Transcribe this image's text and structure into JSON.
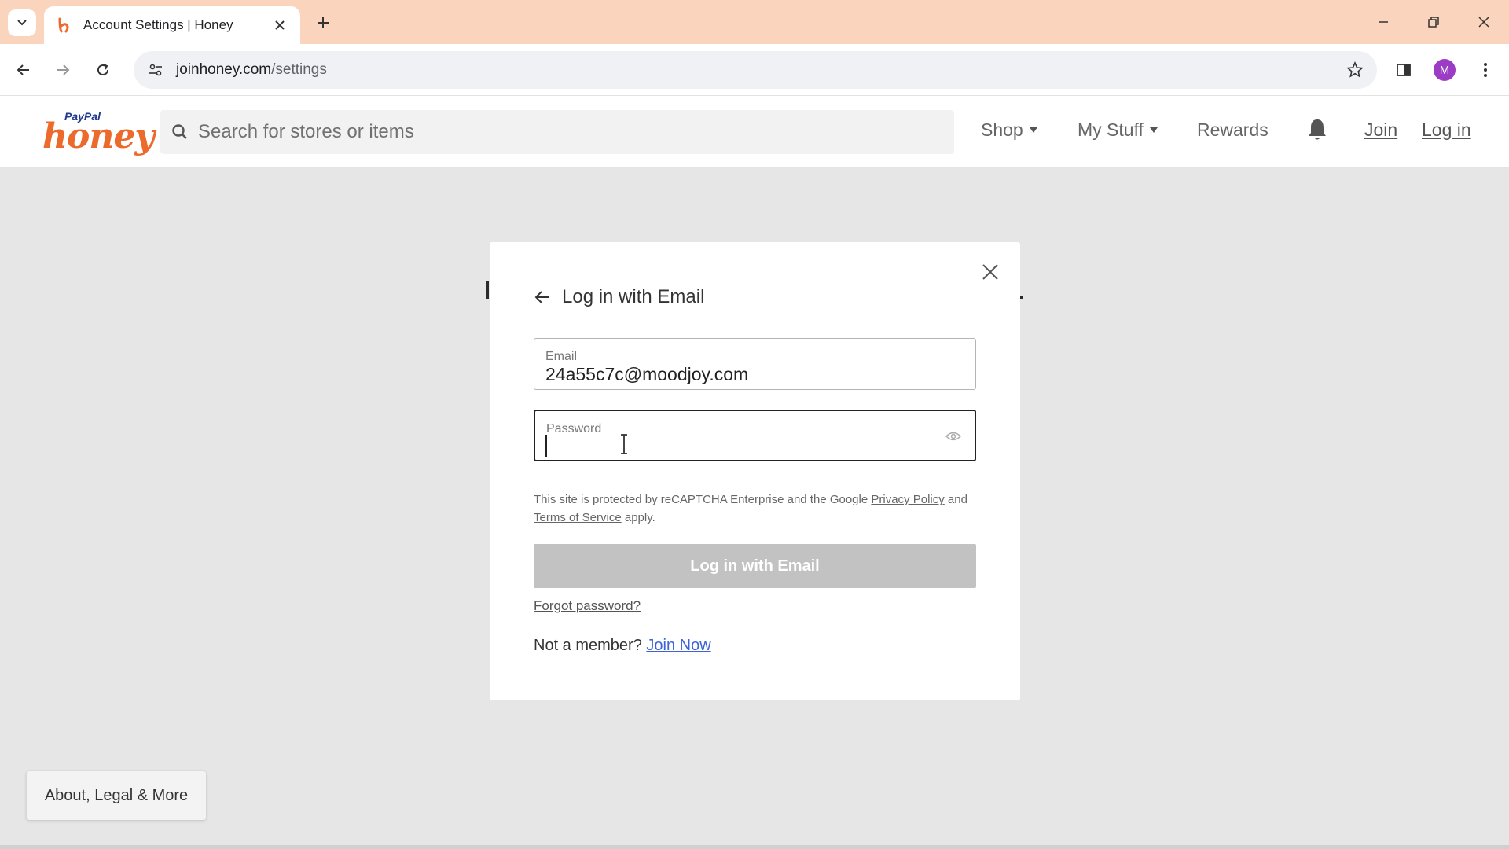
{
  "browser": {
    "tab_title": "Account Settings | Honey",
    "url_host": "joinhoney.com",
    "url_path": "/settings",
    "profile_initial": "M",
    "tabbar_color": "#fbd4be",
    "profile_color": "#9c3bc4"
  },
  "header": {
    "logo_brand": "PayPal",
    "logo_name": "honey",
    "search_placeholder": "Search for stores or items",
    "nav": {
      "shop": "Shop",
      "my_stuff": "My Stuff",
      "rewards": "Rewards"
    },
    "join": "Join",
    "login": "Log in",
    "brand_color": "#ec6a2c"
  },
  "modal": {
    "title": "Log in with Email",
    "email_label": "Email",
    "email_value": "24a55c7c@moodjoy.com",
    "password_label": "Password",
    "password_value": "",
    "recaptcha_prefix": "This site is protected by reCAPTCHA Enterprise and the Google ",
    "privacy_policy": "Privacy Policy",
    "recaptcha_and": " and ",
    "terms": "Terms of Service",
    "recaptcha_suffix": " apply.",
    "submit_label": "Log in with Email",
    "forgot": "Forgot password?",
    "not_member": "Not a member? ",
    "join_now": "Join Now",
    "link_color": "#3d63d6",
    "button_disabled_color": "#c2c2c2"
  },
  "footer": {
    "about": "About, Legal & More"
  }
}
